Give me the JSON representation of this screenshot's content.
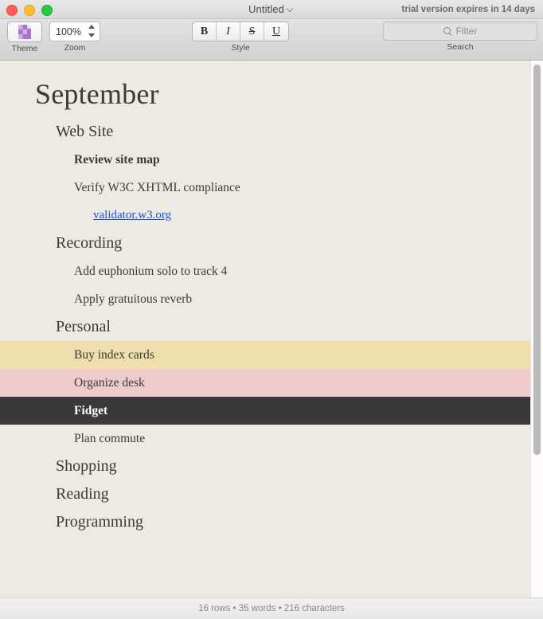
{
  "window": {
    "title": "Untitled",
    "trial_notice": "trial version expires in 14 days"
  },
  "toolbar": {
    "theme": {
      "label": "Theme",
      "icon": "theme-swatch-icon"
    },
    "zoom": {
      "label": "Zoom",
      "value": "100%"
    },
    "style": {
      "label": "Style",
      "buttons": [
        {
          "name": "bold",
          "glyph": "B"
        },
        {
          "name": "italic",
          "glyph": "I"
        },
        {
          "name": "strikethrough",
          "glyph": "S"
        },
        {
          "name": "underline",
          "glyph": "U"
        }
      ]
    },
    "search": {
      "label": "Search",
      "placeholder": "Filter",
      "value": ""
    }
  },
  "document": {
    "heading": "September",
    "rows": [
      {
        "text": "Web Site",
        "level": 1,
        "style": "normal",
        "highlight": "none"
      },
      {
        "text": "Review site map",
        "level": 2,
        "style": "bold",
        "highlight": "none"
      },
      {
        "text": "Verify W3C XHTML compliance",
        "level": 2,
        "style": "normal",
        "highlight": "none"
      },
      {
        "text": "validator.w3.org",
        "level": 3,
        "style": "link",
        "highlight": "none"
      },
      {
        "text": "Recording",
        "level": 1,
        "style": "normal",
        "highlight": "none"
      },
      {
        "text": "Add euphonium solo to track 4",
        "level": 2,
        "style": "normal",
        "highlight": "none"
      },
      {
        "text": "Apply gratuitous reverb",
        "level": 2,
        "style": "normal",
        "highlight": "none"
      },
      {
        "text": "Personal",
        "level": 1,
        "style": "normal",
        "highlight": "none"
      },
      {
        "text": "Buy index cards",
        "level": 2,
        "style": "normal",
        "highlight": "yellow"
      },
      {
        "text": "Organize desk",
        "level": 2,
        "style": "normal",
        "highlight": "pink"
      },
      {
        "text": "Fidget",
        "level": 2,
        "style": "normal",
        "highlight": "dark"
      },
      {
        "text": "Plan commute",
        "level": 2,
        "style": "normal",
        "highlight": "none"
      },
      {
        "text": "Shopping",
        "level": 1,
        "style": "normal",
        "highlight": "none"
      },
      {
        "text": "Reading",
        "level": 1,
        "style": "normal",
        "highlight": "none"
      },
      {
        "text": "Programming",
        "level": 1,
        "style": "normal",
        "highlight": "none"
      }
    ]
  },
  "status": {
    "text": "16 rows • 35 words • 216 characters"
  },
  "colors": {
    "paper": "#eceae2",
    "highlight_yellow": "#efdfac",
    "highlight_pink": "#efcbcb",
    "highlight_dark": "#393939",
    "link": "#1a4fd6",
    "text": "#3b3a38"
  }
}
